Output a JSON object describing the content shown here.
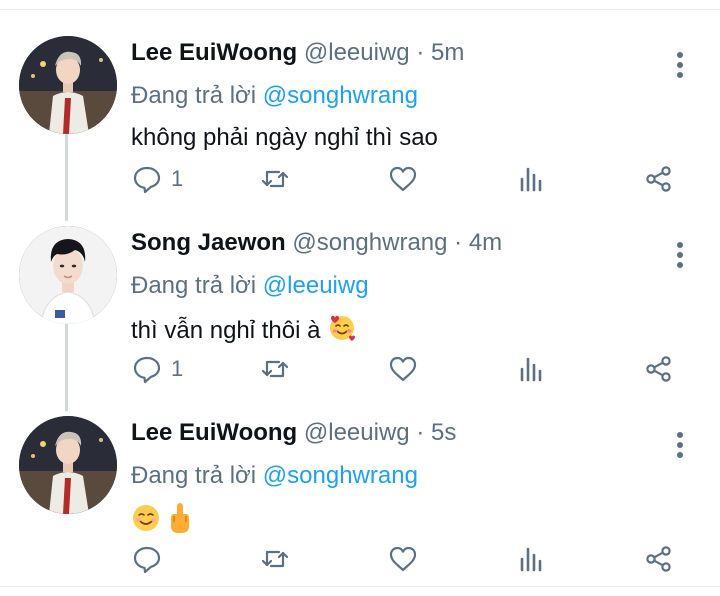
{
  "colors": {
    "accent": "#1da1f2",
    "muted": "#5b7083",
    "text": "#0f1419",
    "divider": "#e6ecf0",
    "thread": "#cfd9de"
  },
  "tweets": [
    {
      "name": "Lee EuiWoong",
      "handle": "@leeuiwg",
      "dot": "·",
      "time": "5m",
      "reply_prefix": "Đang trả lời",
      "reply_to": "@songhwrang",
      "text": "không phải ngày nghỉ thì sao",
      "emojis": [],
      "reply_count": "1",
      "icons": [
        "reply-icon",
        "retweet-icon",
        "like-icon",
        "analytics-icon",
        "share-icon",
        "more-icon"
      ]
    },
    {
      "name": "Song Jaewon",
      "handle": "@songhwrang",
      "dot": "·",
      "time": "4m",
      "reply_prefix": "Đang trả lời",
      "reply_to": "@leeuiwg",
      "text": "thì vẫn nghỉ thôi à",
      "emojis": [
        "smiling-face-with-hearts"
      ],
      "reply_count": "1",
      "icons": [
        "reply-icon",
        "retweet-icon",
        "like-icon",
        "analytics-icon",
        "share-icon",
        "more-icon"
      ]
    },
    {
      "name": "Lee EuiWoong",
      "handle": "@leeuiwg",
      "dot": "·",
      "time": "5s",
      "reply_prefix": "Đang trả lời",
      "reply_to": "@songhwrang",
      "text": "",
      "emojis": [
        "smiling-face",
        "middle-finger"
      ],
      "reply_count": "",
      "icons": [
        "reply-icon",
        "retweet-icon",
        "like-icon",
        "analytics-icon",
        "share-icon",
        "more-icon"
      ]
    }
  ]
}
